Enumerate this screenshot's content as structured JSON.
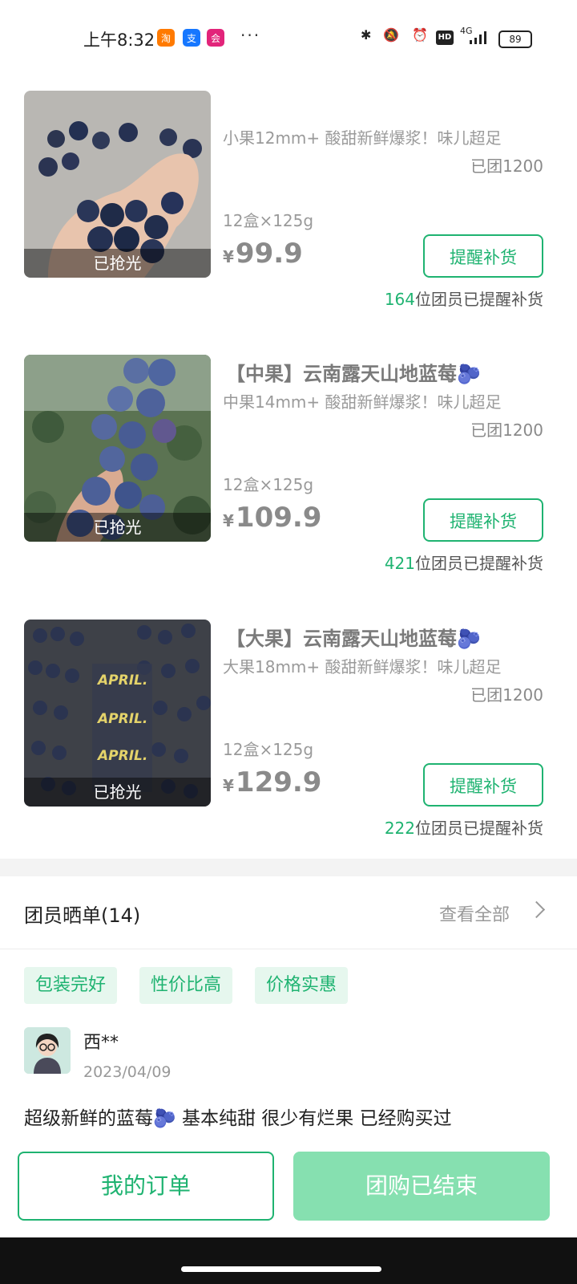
{
  "status_bar": {
    "time": "上午8:32",
    "more": "···",
    "network": "4G",
    "hd": "HD",
    "battery": "89"
  },
  "colors": {
    "accent": "#1fb371",
    "accent_light": "#86e0b0",
    "tag_bg": "#e6f7ee"
  },
  "nav": {
    "icons": [
      "back-icon",
      "heart-icon",
      "shutter-icon",
      "share-icon",
      "more-icon",
      "record-icon"
    ]
  },
  "products": [
    {
      "title": "",
      "subtitle": "小果12mm+ 酸甜新鲜爆浆！味儿超足",
      "grouped": "已团1200",
      "spec": "12盒×125g",
      "price_symbol": "¥",
      "price": "99.9",
      "remind_label": "提醒补货",
      "remind_count": "164",
      "remind_suffix": "位团员已提醒补货",
      "soldout": "已抢光"
    },
    {
      "title": "【中果】云南露天山地蓝莓🫐",
      "subtitle": "中果14mm+ 酸甜新鲜爆浆！味儿超足",
      "grouped": "已团1200",
      "spec": "12盒×125g",
      "price_symbol": "¥",
      "price": "109.9",
      "remind_label": "提醒补货",
      "remind_count": "421",
      "remind_suffix": "位团员已提醒补货",
      "soldout": "已抢光"
    },
    {
      "title": "【大果】云南露天山地蓝莓🫐",
      "subtitle": "大果18mm+ 酸甜新鲜爆浆！味儿超足",
      "grouped": "已团1200",
      "spec": "12盒×125g",
      "price_symbol": "¥",
      "price": "129.9",
      "remind_label": "提醒补货",
      "remind_count": "222",
      "remind_suffix": "位团员已提醒补货",
      "soldout": "已抢光",
      "box_label": "APRIL."
    }
  ],
  "reviews": {
    "title": "团员晒单(14)",
    "view_all": "查看全部",
    "tags": [
      "包装完好",
      "性价比高",
      "价格实惠"
    ],
    "user": "西**",
    "date": "2023/04/09",
    "text": "超级新鲜的蓝莓🫐 基本纯甜 很少有烂果 已经购买过"
  },
  "bottom": {
    "orders_label": "我的订单",
    "ended_label": "团购已结束"
  }
}
